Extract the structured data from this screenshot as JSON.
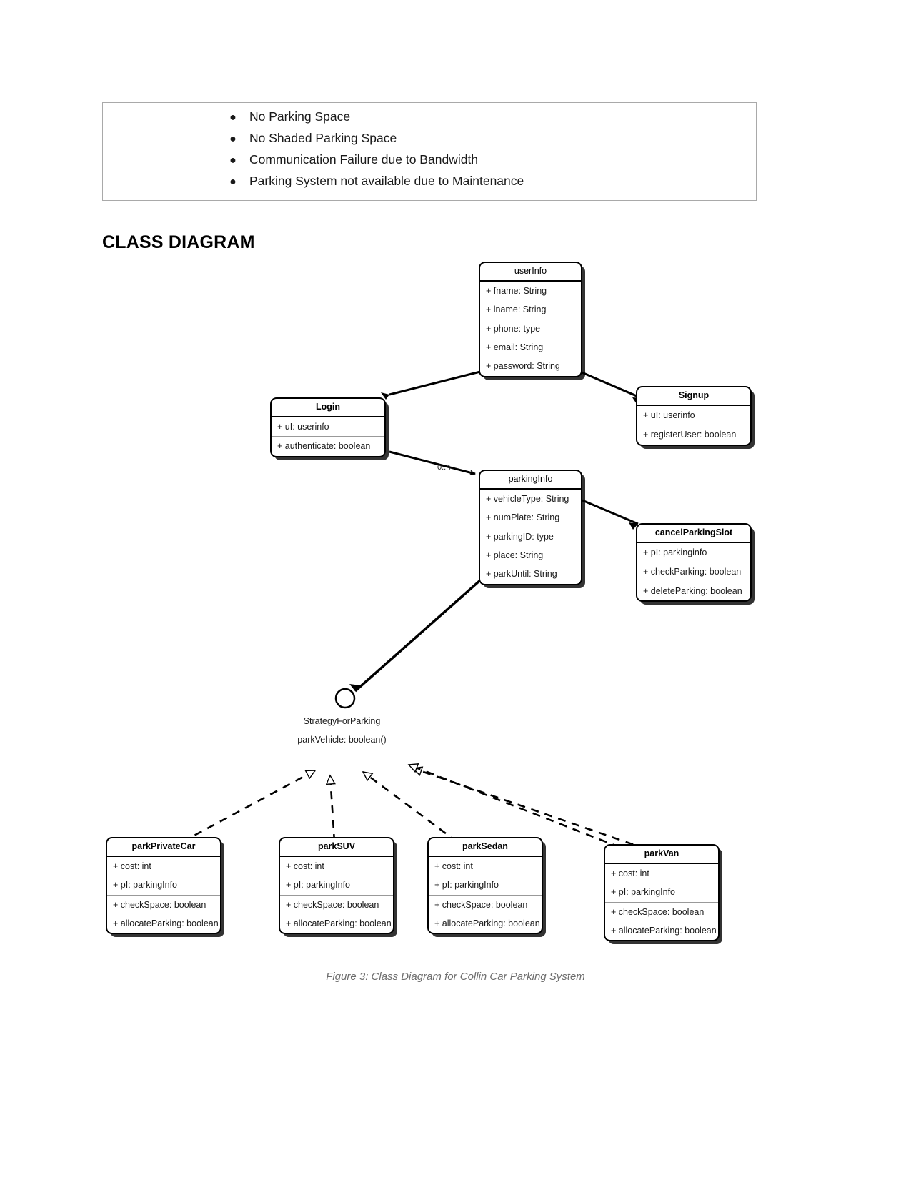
{
  "issue_table": {
    "bullets": [
      "No Parking Space",
      "No Shaded Parking Space",
      "Communication Failure due to Bandwidth",
      "Parking System not available due to Maintenance"
    ]
  },
  "section": {
    "heading": "CLASS DIAGRAM"
  },
  "caption": "Figure 3: Class Diagram for Collin Car Parking System",
  "diagram": {
    "multiplicity": "0..n",
    "interface": {
      "name": "StrategyForParking",
      "operation": "parkVehicle: boolean()"
    },
    "classes": [
      {
        "name": "userInfo",
        "bold": false,
        "attributes": [
          "+ fname: String",
          "+ lname: String",
          "+ phone: type",
          "+ email: String",
          "+ password: String"
        ],
        "methods": []
      },
      {
        "name": "Login",
        "bold": true,
        "attributes": [
          "+ uI: userinfo"
        ],
        "methods": [
          "+ authenticate: boolean"
        ]
      },
      {
        "name": "Signup",
        "bold": true,
        "attributes": [
          "+ uI: userinfo"
        ],
        "methods": [
          "+ registerUser: boolean"
        ]
      },
      {
        "name": "parkingInfo",
        "bold": false,
        "attributes": [
          "+ vehicleType: String",
          "+ numPlate: String",
          "+ parkingID: type",
          "+ place: String",
          "+ parkUntil: String"
        ],
        "methods": []
      },
      {
        "name": "cancelParkingSlot",
        "bold": true,
        "attributes": [
          "+ pI: parkinginfo"
        ],
        "methods": [
          "+ checkParking: boolean",
          "+ deleteParking: boolean"
        ]
      },
      {
        "name": "parkPrivateCar",
        "bold": true,
        "attributes": [
          "+ cost: int",
          "+ pI: parkingInfo"
        ],
        "methods": [
          "+ checkSpace: boolean",
          "+ allocateParking: boolean"
        ]
      },
      {
        "name": "parkSUV",
        "bold": true,
        "attributes": [
          "+ cost: int",
          "+ pI: parkingInfo"
        ],
        "methods": [
          "+ checkSpace: boolean",
          "+ allocateParking: boolean"
        ]
      },
      {
        "name": "parkSedan",
        "bold": true,
        "attributes": [
          "+ cost: int",
          "+ pI: parkingInfo"
        ],
        "methods": [
          "+ checkSpace: boolean",
          "+ allocateParking: boolean"
        ]
      },
      {
        "name": "parkVan",
        "bold": true,
        "attributes": [
          "+ cost: int",
          "+ pI: parkingInfo"
        ],
        "methods": [
          "+ checkSpace: boolean",
          "+ allocateParking: boolean"
        ]
      }
    ]
  }
}
